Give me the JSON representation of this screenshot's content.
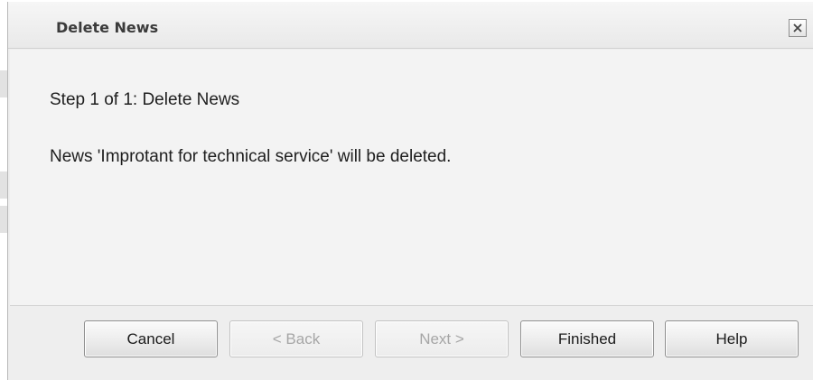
{
  "dialog": {
    "title": "Delete News",
    "close_icon": "close-icon",
    "step": "Step 1 of 1: Delete News",
    "message": "News 'Improtant for technical service' will be deleted."
  },
  "buttons": {
    "cancel": "Cancel",
    "back": "< Back",
    "next": "Next >",
    "finished": "Finished",
    "help": "Help"
  }
}
